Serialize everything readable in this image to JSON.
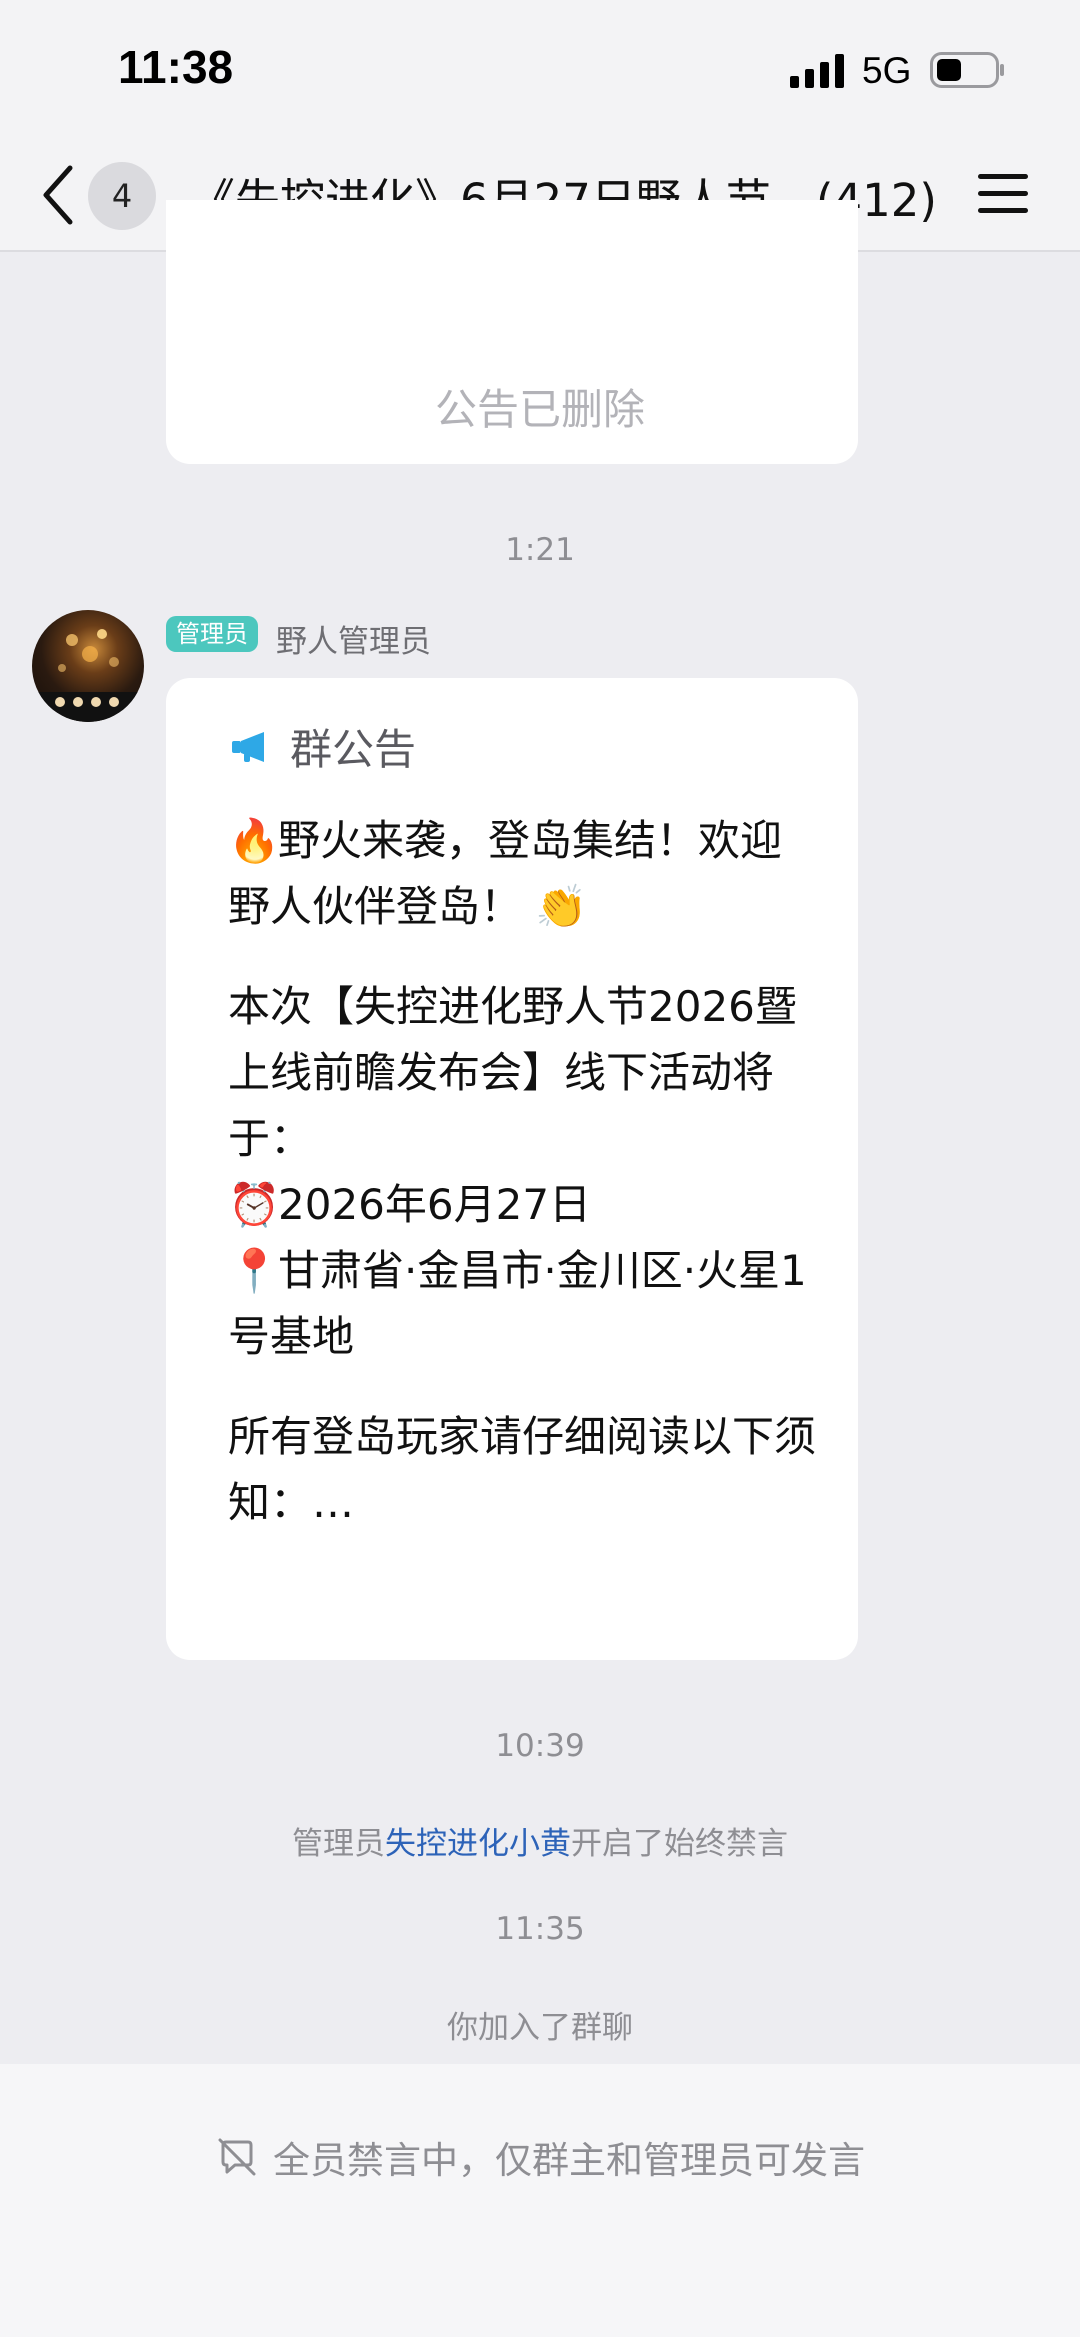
{
  "status_bar": {
    "time": "11:38",
    "network": "5G"
  },
  "nav": {
    "unread_count": "4",
    "title": "《失控进化》6月27日野人节…(412)"
  },
  "messages": {
    "deleted_notice_text": "公告已删除",
    "time_1": "1:21",
    "sender": {
      "role_tag": "管理员",
      "name": "野人管理员"
    },
    "notice": {
      "icon": "megaphone-icon",
      "title": "群公告",
      "line1": "野火来袭，登岛集结！欢迎野人伙伴登岛！",
      "line1_emoji_start": "🔥",
      "line1_emoji_end": "👏",
      "line2": "本次【失控进化野人节2026暨上线前瞻发布会】线下活动将于：",
      "date_emoji": "⏰",
      "date": "2026年6月27日",
      "location_emoji": "📍",
      "location": "甘肃省·金昌市·金川区·火星1号基地",
      "line3": "所有登岛玩家请仔细阅读以下须知：…"
    },
    "time_2": "10:39",
    "system_mute": {
      "prefix": "管理员",
      "admin_name": "失控进化小黄",
      "suffix": "开启了始终禁言"
    },
    "time_3": "11:35",
    "system_join": "你加入了群聊"
  },
  "bottom": {
    "mute_text": "全员禁言中，仅群主和管理员可发言"
  },
  "colors": {
    "background": "#EDEDF1",
    "admin_tag": "#4CC7BE",
    "link": "#2D63B8",
    "megaphone": "#2EA8E6"
  }
}
